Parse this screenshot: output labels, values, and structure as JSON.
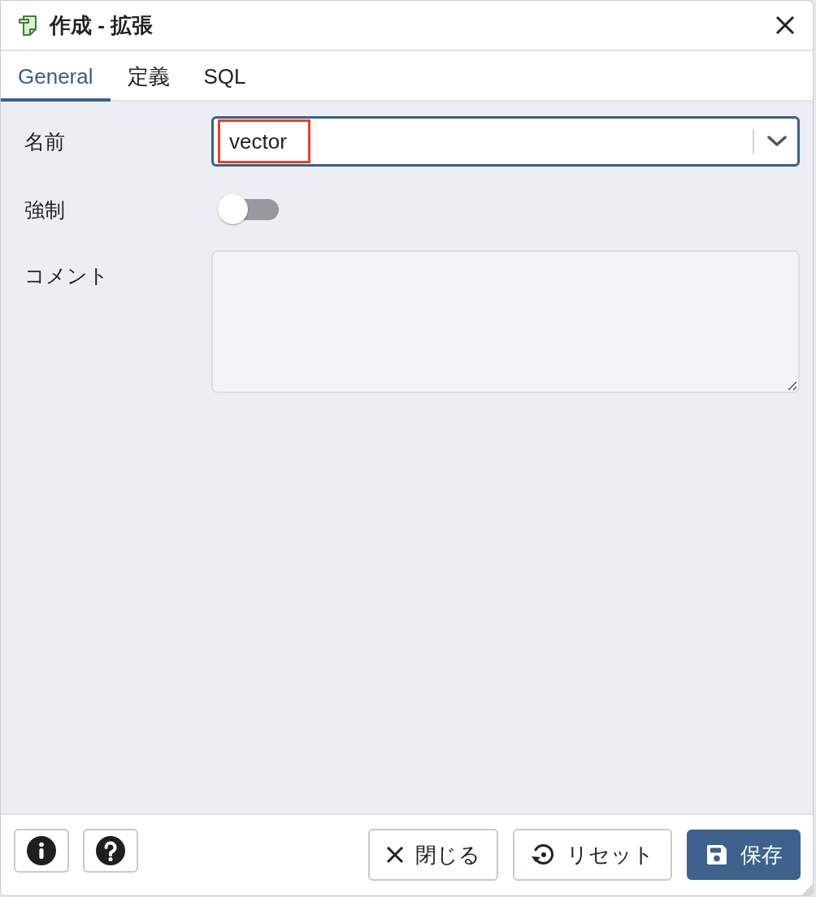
{
  "dialog": {
    "title": "作成 - 拡張"
  },
  "tabs": [
    {
      "label": "General",
      "selected": true
    },
    {
      "label": "定義",
      "selected": false
    },
    {
      "label": "SQL",
      "selected": false
    }
  ],
  "fields": [
    {
      "kind": "select",
      "label": "名前",
      "value": "vector",
      "highlighted": true
    },
    {
      "kind": "toggle",
      "label": "強制",
      "on": false
    },
    {
      "kind": "textarea",
      "label": "コメント"
    }
  ],
  "footer": {
    "icon_buttons": [
      {
        "kind": "info"
      },
      {
        "kind": "help"
      }
    ],
    "buttons": [
      {
        "kind": "close",
        "label": "閉じる",
        "primary": false
      },
      {
        "kind": "reset",
        "label": "リセット",
        "primary": false
      },
      {
        "kind": "save",
        "label": "保存",
        "primary": true
      }
    ]
  }
}
